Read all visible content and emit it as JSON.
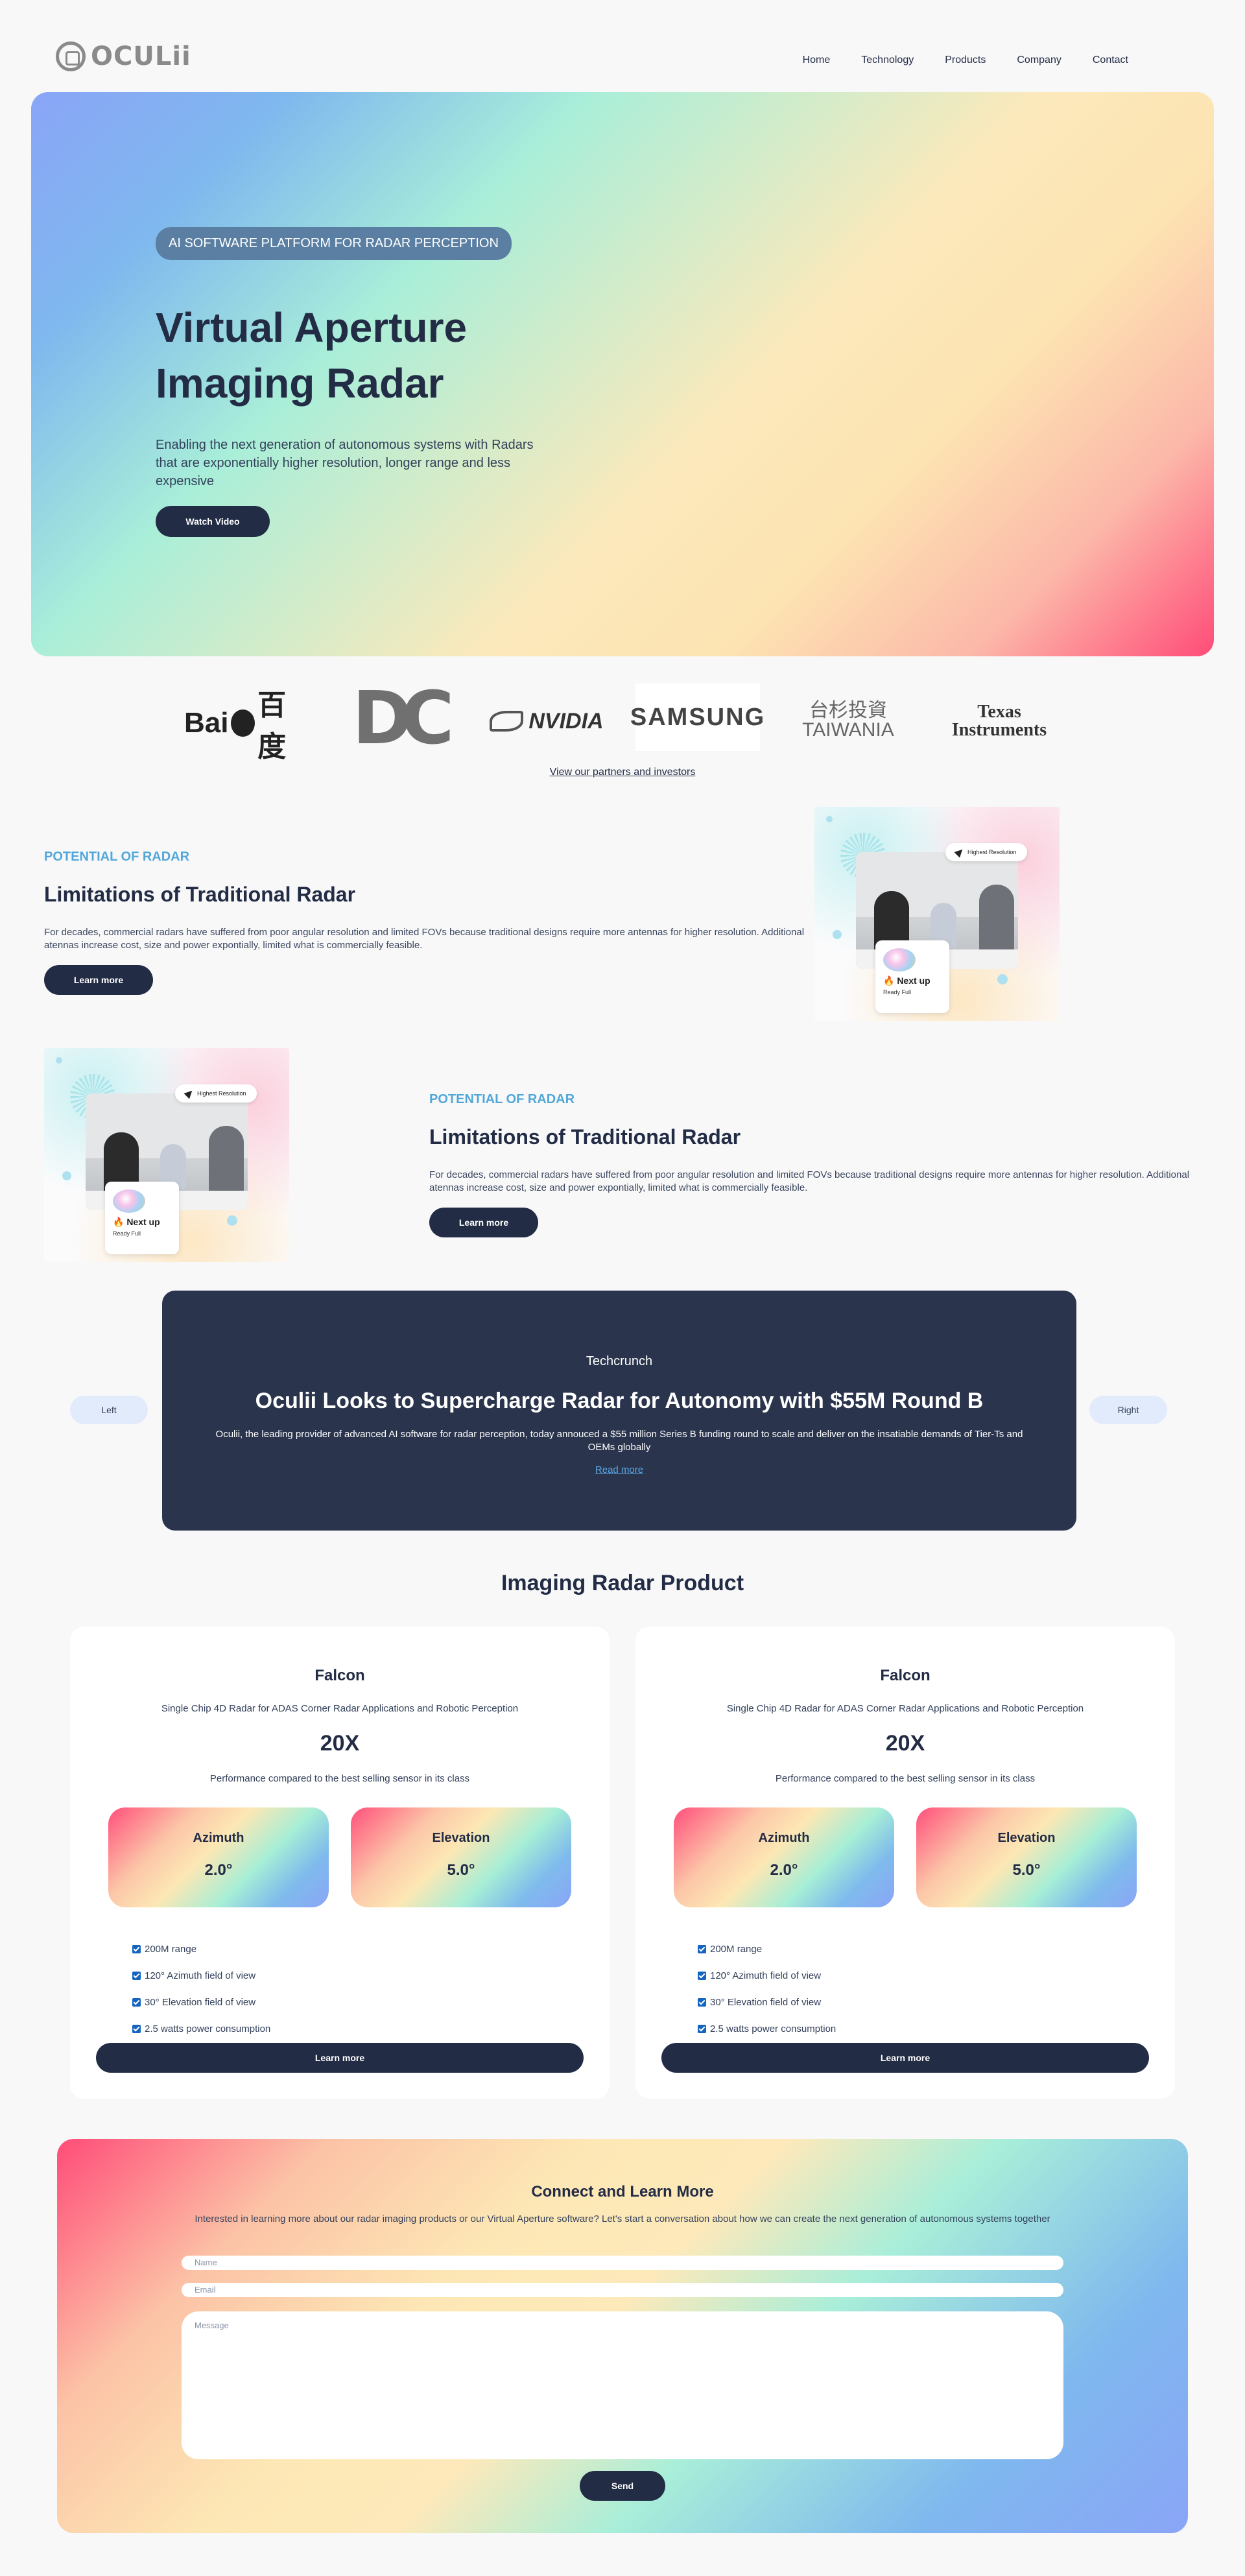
{
  "header": {
    "logo_text": "OCULii",
    "nav": [
      "Home",
      "Technology",
      "Products",
      "Company",
      "Contact"
    ]
  },
  "hero": {
    "badge": "AI SOFTWARE PLATFORM FOR RADAR PERCEPTION",
    "title_line1": "Virtual Aperture",
    "title_line2": "Imaging Radar",
    "description": "Enabling the next generation of autonomous systems with Radars that are exponentially higher resolution, longer range and less expensive",
    "button": "Watch Video"
  },
  "partners": {
    "logos": [
      "Baidu百度",
      "DC",
      "NVIDIA",
      "SAMSUNG",
      "台杉投資 TAIWANIA",
      "Texas Instruments"
    ],
    "baidu": {
      "left": "Bai",
      "right": "百度"
    },
    "dc": "DC",
    "nvidia": "NVIDIA",
    "samsung": "SAMSUNG",
    "taiwania": {
      "cn": "台杉投資",
      "en": "TAIWANIA"
    },
    "ti": {
      "line1": "Texas",
      "line2": "Instruments"
    },
    "link": "View our partners and investors"
  },
  "potential_1": {
    "eyebrow": "POTENTIAL OF RADAR",
    "title": "Limitations of Traditional Radar",
    "description": "For decades, commercial radars have suffered from poor angular resolution and limited FOVs because traditional designs require more antennas for higher resolution. Additional atennas increase cost, size and power expontially, limited what is commercially feasible.",
    "button": "Learn more",
    "illustration": {
      "tag": "Highest Resolution",
      "card_title": "🔥 Next up",
      "card_sub": "Ready Full"
    }
  },
  "potential_2": {
    "eyebrow": "POTENTIAL OF RADAR",
    "title": "Limitations of Traditional Radar",
    "description": "For decades, commercial radars have suffered from poor angular resolution and limited FOVs because traditional designs require more antennas for higher resolution. Additional atennas increase cost, size and power expontially, limited what is commercially feasible.",
    "button": "Learn more",
    "illustration": {
      "tag": "Highest Resolution",
      "card_title": "🔥 Next up",
      "card_sub": "Ready Full"
    }
  },
  "news": {
    "prev": "Left",
    "next": "Right",
    "source": "Techcrunch",
    "title": "Oculii Looks to Supercharge Radar for Autonomy with $55M Round B",
    "description": "Oculii, the leading provider of advanced AI software for radar perception, today annouced a $55 million Series B funding round to scale and deliver on the insatiable demands of Tier-Ts and OEMs globally",
    "link": "Read more"
  },
  "products": {
    "section_title": "Imaging Radar Product",
    "items": [
      {
        "name": "Falcon",
        "subtitle": "Single Chip 4D Radar for ADAS Corner Radar Applications and Robotic Perception",
        "multiplier": "20X",
        "performance": "Performance compared to the best selling sensor in its class",
        "specs": [
          {
            "label": "Azimuth",
            "value": "2.0°"
          },
          {
            "label": "Elevation",
            "value": "5.0°"
          }
        ],
        "features": [
          "200M range",
          "120° Azimuth field of view",
          "30° Elevation field of view",
          "2.5 watts power consumption"
        ],
        "button": "Learn more"
      },
      {
        "name": "Falcon",
        "subtitle": "Single Chip 4D Radar for ADAS Corner Radar Applications and Robotic Perception",
        "multiplier": "20X",
        "performance": "Performance compared to the best selling sensor in its class",
        "specs": [
          {
            "label": "Azimuth",
            "value": "2.0°"
          },
          {
            "label": "Elevation",
            "value": "5.0°"
          }
        ],
        "features": [
          "200M range",
          "120° Azimuth field of view",
          "30° Elevation field of view",
          "2.5 watts power consumption"
        ],
        "button": "Learn more"
      }
    ]
  },
  "contact": {
    "title": "Connect and Learn More",
    "description": "Interested in learning more about our radar imaging products or our Virtual Aperture software? Let's start a conversation about how we can create the next generation of autonomous systems together",
    "name_placeholder": "Name",
    "email_placeholder": "Email",
    "message_placeholder": "Message",
    "send": "Send"
  },
  "colors": {
    "navy": "#232c45",
    "accent_blue": "#52a7d9",
    "news_bg": "#2a344d",
    "link_blue": "#5aa9e6"
  }
}
